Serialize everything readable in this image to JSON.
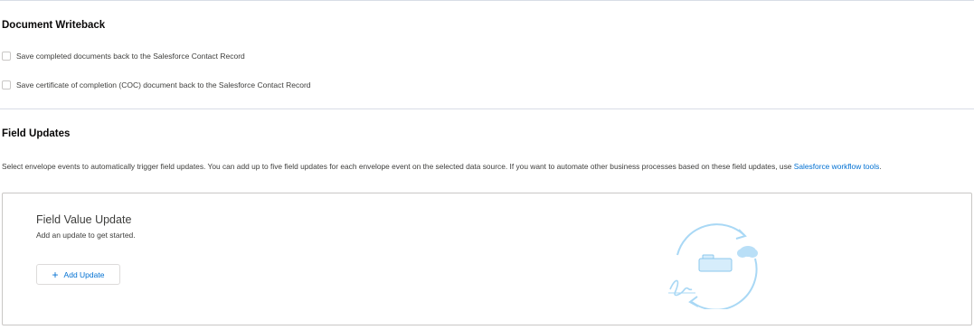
{
  "writeback": {
    "title": "Document Writeback",
    "options": [
      {
        "label": "Save completed documents back to the Salesforce Contact Record",
        "checked": false
      },
      {
        "label": "Save certificate of completion (COC) document back to the Salesforce Contact Record",
        "checked": false
      }
    ]
  },
  "field_updates": {
    "title": "Field Updates",
    "description": "Select envelope events to automatically trigger field updates. You can add up to five field updates for each envelope event on the selected data source. If you want to automate other business processes based on these field updates, use",
    "link_text": "Salesforce workflow tools",
    "description_end": ".",
    "card": {
      "title": "Field Value Update",
      "subtitle": "Add an update to get started.",
      "add_button": "Add Update"
    }
  },
  "colors": {
    "link": "#0070d2",
    "illustration": "#a9d8f5",
    "border": "#d8dde6"
  },
  "icons": {
    "add": "plus-icon",
    "illustration": "sync-cloud-illustration"
  }
}
